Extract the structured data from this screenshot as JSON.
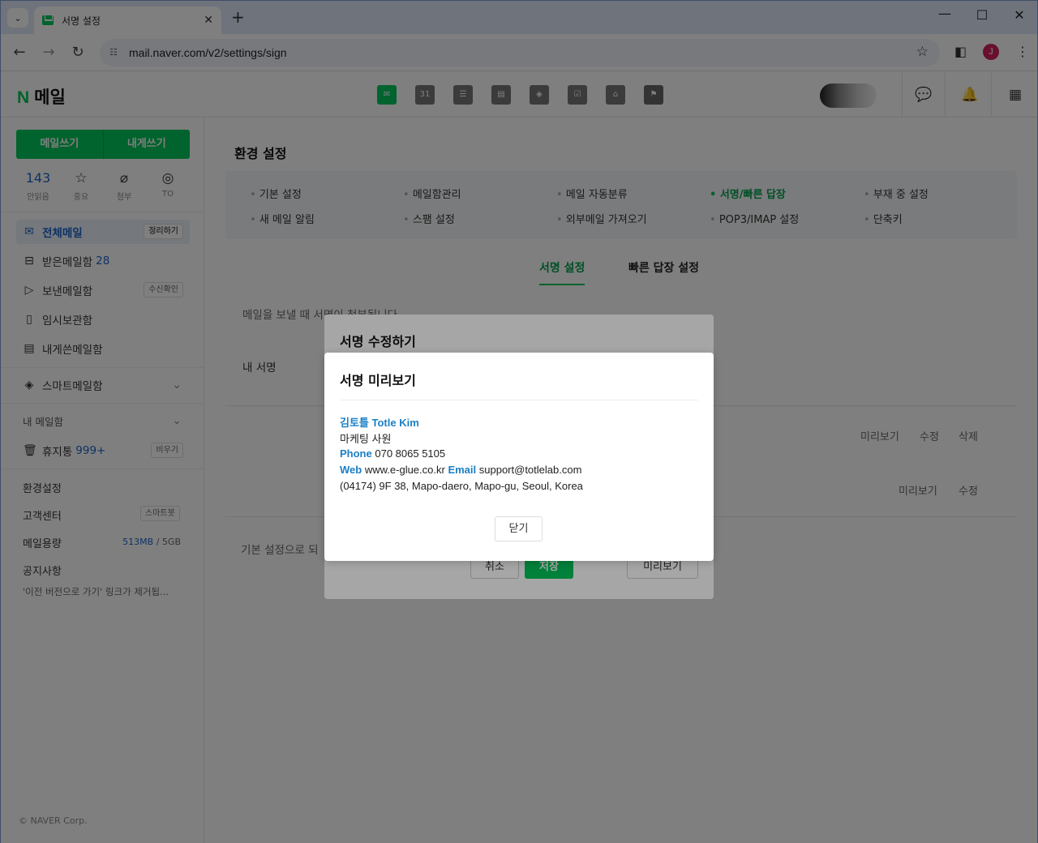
{
  "browser": {
    "tab_title": "서명 설정",
    "url": "mail.naver.com/v2/settings/sign",
    "avatar_letter": "J"
  },
  "app": {
    "logo_n": "N",
    "logo_text": "메일",
    "calendar_day": "31"
  },
  "sidebar": {
    "write_mail": "메일쓰기",
    "write_self": "내게쓰기",
    "quick": [
      {
        "value": "143",
        "label": "안읽음"
      },
      {
        "label": "중요"
      },
      {
        "label": "첨부"
      },
      {
        "label": "TO"
      }
    ],
    "folders": {
      "all": "전체메일",
      "all_chip": "정리하기",
      "inbox": "받은메일함",
      "inbox_count": "28",
      "sent": "보낸메일함",
      "sent_chip": "수신확인",
      "drafts": "임시보관함",
      "self": "내게쓴메일함",
      "smart": "스마트메일함",
      "my": "내 메일함",
      "trash": "휴지통",
      "trash_count": "999+",
      "trash_chip": "비우기"
    },
    "settings": "환경설정",
    "support": "고객센터",
    "support_chip": "스마트봇",
    "capacity": "메일용량",
    "capacity_used": "513MB",
    "capacity_sep": "/",
    "capacity_total": "5GB",
    "notice": "공지사항",
    "notice_text": "'이전 버전으로 가기' 링크가 제거됩...",
    "copyright": "© NAVER Corp."
  },
  "main": {
    "title": "환경 설정",
    "menu": [
      "기본 설정",
      "메일함관리",
      "메일 자동분류",
      "서명/빠른 답장",
      "부재 중 설정",
      "새 메일 알림",
      "스팸 설정",
      "외부메일 가져오기",
      "POP3/IMAP 설정",
      "단축키"
    ],
    "subtabs": [
      "서명 설정",
      "빠른 답장 설정"
    ],
    "desc": "메일을 보낼 때 서명이 첨부됩니다",
    "my_sign": "내 서명",
    "row1": [
      "미리보기",
      "수정",
      "삭제"
    ],
    "row2": [
      "미리보기",
      "수정"
    ],
    "reset_text": "기본 설정으로 되"
  },
  "edit_dialog": {
    "title": "서명 수정하기",
    "cancel": "취소",
    "save": "저장",
    "preview": "미리보기"
  },
  "preview_dialog": {
    "title": "서명 미리보기",
    "name": "김토틀 Totle Kim",
    "position": "마케팅 사원",
    "phone_label": "Phone",
    "phone": "070 8065 5105",
    "web_label": "Web",
    "web": "www.e-glue.co.kr",
    "email_label": "Email",
    "email": "support@totlelab.com",
    "address": "(04174) 9F 38, Mapo-daero, Mapo-gu, Seoul, Korea",
    "close": "닫기"
  }
}
